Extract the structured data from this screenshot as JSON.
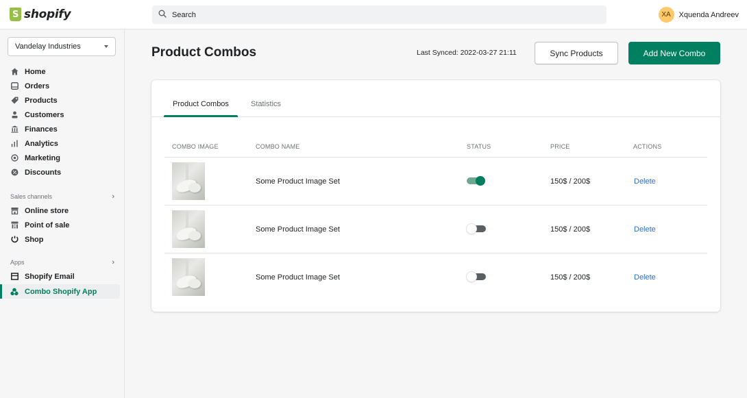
{
  "topbar": {
    "logo_text": "shopify",
    "search_placeholder": "Search",
    "user_initials": "XA",
    "user_name": "Xquenda Andreev"
  },
  "sidebar": {
    "store_name": "Vandelay Industries",
    "main_nav": [
      {
        "label": "Home",
        "icon": "home-icon"
      },
      {
        "label": "Orders",
        "icon": "orders-icon"
      },
      {
        "label": "Products",
        "icon": "tag-icon"
      },
      {
        "label": "Customers",
        "icon": "person-icon"
      },
      {
        "label": "Finances",
        "icon": "bank-icon"
      },
      {
        "label": "Analytics",
        "icon": "bar-chart-icon"
      },
      {
        "label": "Marketing",
        "icon": "target-icon"
      },
      {
        "label": "Discounts",
        "icon": "discount-icon"
      }
    ],
    "sales_channels_heading": "Sales channels",
    "sales_channels": [
      {
        "label": "Online store",
        "icon": "store-icon"
      },
      {
        "label": "Point of sale",
        "icon": "pos-icon"
      },
      {
        "label": "Shop",
        "icon": "shop-icon"
      }
    ],
    "apps_heading": "Apps",
    "apps": [
      {
        "label": "Shopify Email",
        "icon": "email-icon"
      },
      {
        "label": "Combo Shopify App",
        "icon": "app-icon",
        "active": true
      }
    ]
  },
  "page": {
    "title": "Product Combos",
    "last_synced": "Last Synced: 2022-03-27 21:11",
    "sync_button": "Sync Products",
    "add_button": "Add New Combo"
  },
  "tabs": [
    {
      "label": "Product Combos",
      "active": true
    },
    {
      "label": "Statistics",
      "active": false
    }
  ],
  "table": {
    "headers": [
      "COMBO IMAGE",
      "COMBO NAME",
      "STATUS",
      "PRICE",
      "ACTIONS"
    ],
    "rows": [
      {
        "name": "Some Product Image Set",
        "status_on": true,
        "price": "150$ / 200$",
        "action": "Delete"
      },
      {
        "name": "Some Product Image Set",
        "status_on": false,
        "price": "150$ / 200$",
        "action": "Delete"
      },
      {
        "name": "Some Product Image Set",
        "status_on": false,
        "price": "150$ / 200$",
        "action": "Delete"
      }
    ]
  },
  "colors": {
    "primary": "#008060",
    "link": "#2c6ecb",
    "avatar": "#ffc96b"
  }
}
